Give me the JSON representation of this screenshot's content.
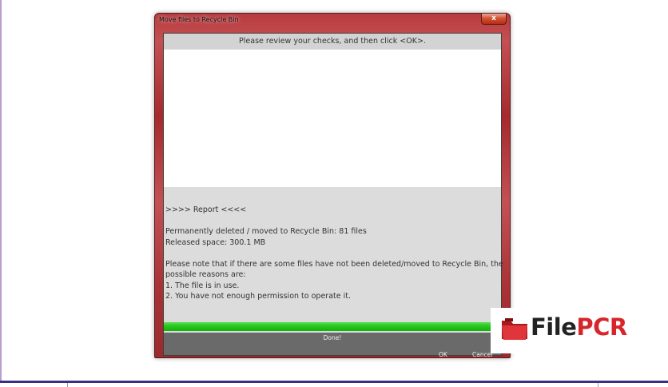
{
  "window": {
    "title": "Move files to Recycle Bin",
    "close_label": "x"
  },
  "header": {
    "instruction": "Please review your checks, and then click <OK>."
  },
  "report": {
    "heading": ">>>> Report <<<<",
    "deleted": "Permanently deleted / moved to Recycle Bin: 81 files",
    "released": "Released space: 300.1 MB",
    "note_line1": "Please note that if there are some files have not been deleted/moved to Recycle Bin, the",
    "note_line2": "possible reasons are:",
    "reason1": "1. The file is in use.",
    "reason2": "2. You have not enough permission to operate it."
  },
  "progress": {
    "value": 1.0,
    "status": "Done!"
  },
  "buttons": {
    "ok": "OK",
    "cancel": "Cancel"
  },
  "watermark": {
    "text_main": "File",
    "text_accent": "PCR",
    "icon": "folder-icon"
  },
  "colors": {
    "frame": "#b83b3e",
    "progress": "#23c41b",
    "watermark_accent": "#d7262b"
  }
}
